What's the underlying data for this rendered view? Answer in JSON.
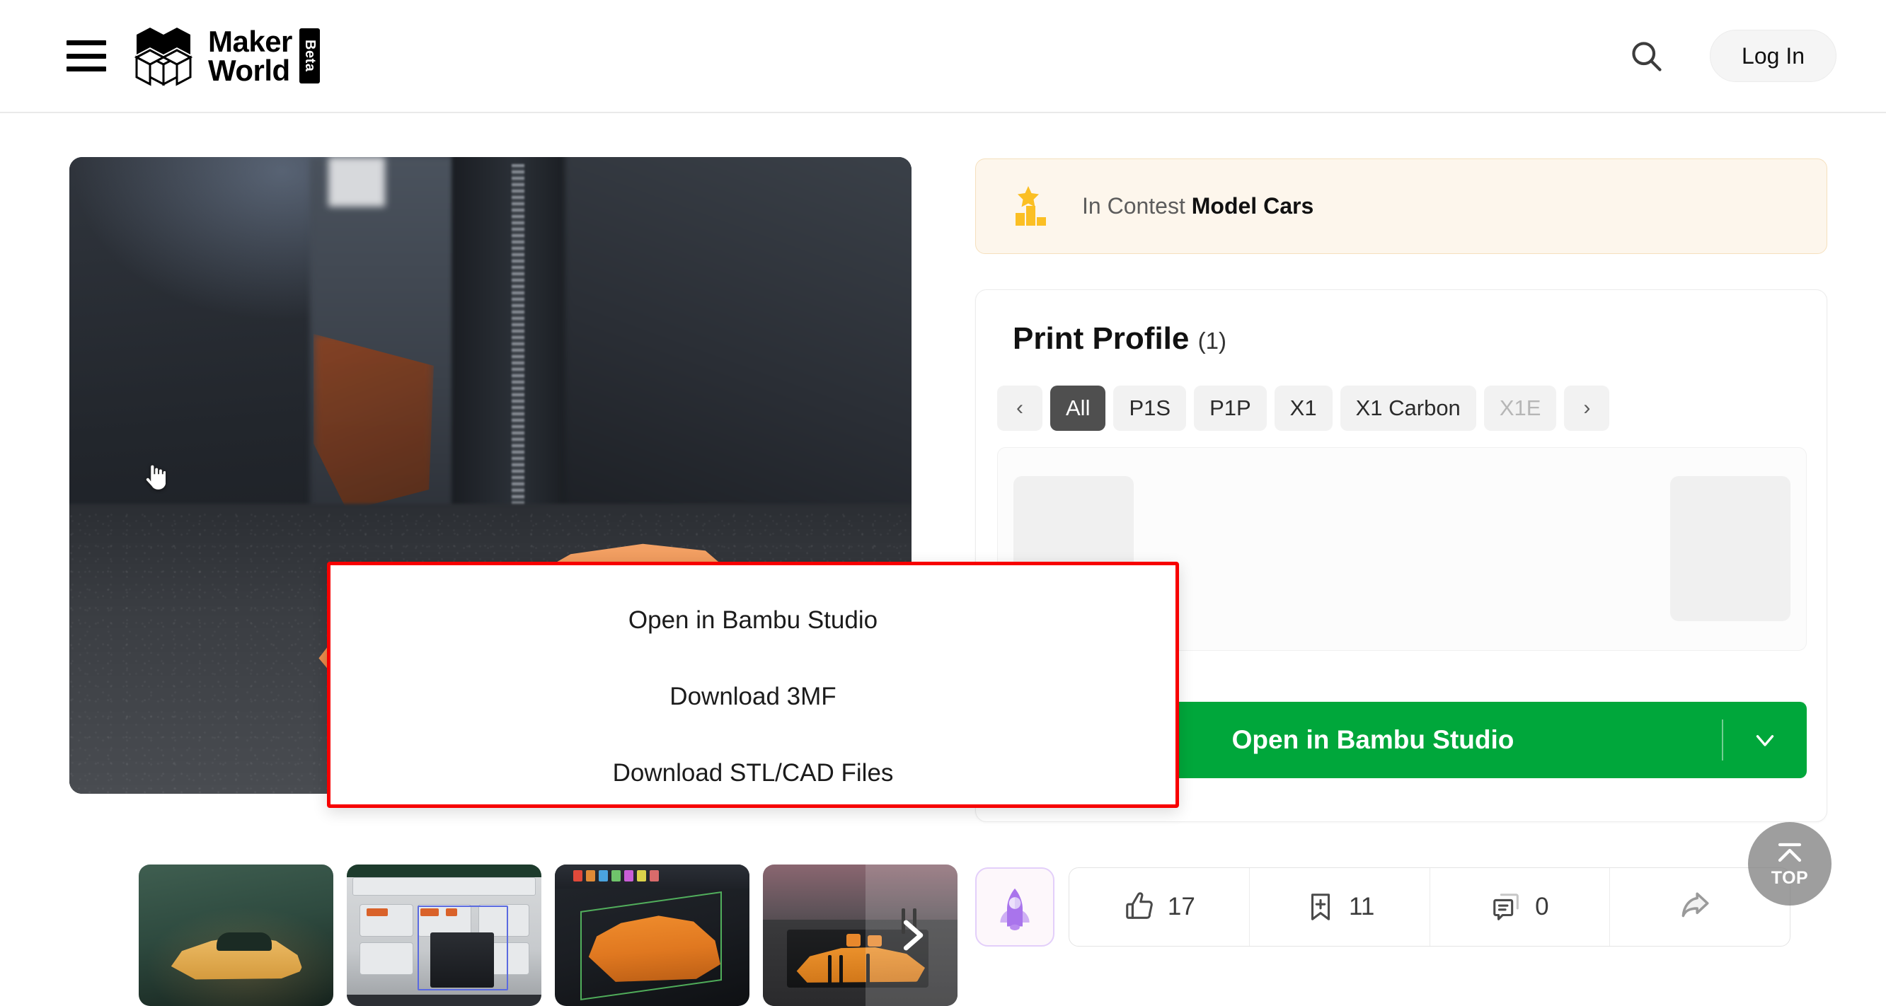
{
  "header": {
    "menu_icon": "hamburger-icon",
    "brand_line1": "Maker",
    "brand_line2": "World",
    "brand_badge": "Beta",
    "search_icon": "search-icon",
    "login_label": "Log In"
  },
  "gallery": {
    "hero_alt": "Orange 3D printed sports car model on printer bed",
    "cursor": "pointing-hand-cursor",
    "next_icon": "chevron-right-icon",
    "thumbnails": [
      {
        "alt": "Printed orange car on green-lit printer bed"
      },
      {
        "alt": "Slicer software plate view with printed parts"
      },
      {
        "alt": "3D CAD model of orange car in bounding box"
      },
      {
        "alt": "Printed car body with support structures on plate"
      }
    ]
  },
  "contest": {
    "icon": "podium-star-icon",
    "prefix": "In Contest",
    "name": "Model Cars"
  },
  "print_profile": {
    "title": "Print Profile",
    "count": "(1)",
    "prev_icon": "chevron-left-icon",
    "next_icon": "chevron-right-icon",
    "filters": [
      {
        "label": "All",
        "state": "active"
      },
      {
        "label": "P1S",
        "state": "default"
      },
      {
        "label": "P1P",
        "state": "default"
      },
      {
        "label": "X1",
        "state": "default"
      },
      {
        "label": "X1 Carbon",
        "state": "default"
      },
      {
        "label": "X1E",
        "state": "muted"
      }
    ]
  },
  "dropdown": {
    "highlight_color": "#f70000",
    "items": [
      {
        "label": "Open in Bambu Studio"
      },
      {
        "label": "Download 3MF"
      },
      {
        "label": "Download STL/CAD Files"
      }
    ]
  },
  "cta": {
    "label": "Open in Bambu Studio",
    "caret_icon": "chevron-down-icon",
    "color": "#00a73b"
  },
  "back_to_top": {
    "icon": "chevron-up-bar-icon",
    "label": "TOP"
  },
  "stats": {
    "boost_icon": "rocket-icon",
    "items": [
      {
        "icon": "thumbs-up-icon",
        "value": "17"
      },
      {
        "icon": "bookmark-plus-icon",
        "value": "11"
      },
      {
        "icon": "comment-icon",
        "value": "0"
      },
      {
        "icon": "share-icon",
        "value": ""
      }
    ]
  }
}
